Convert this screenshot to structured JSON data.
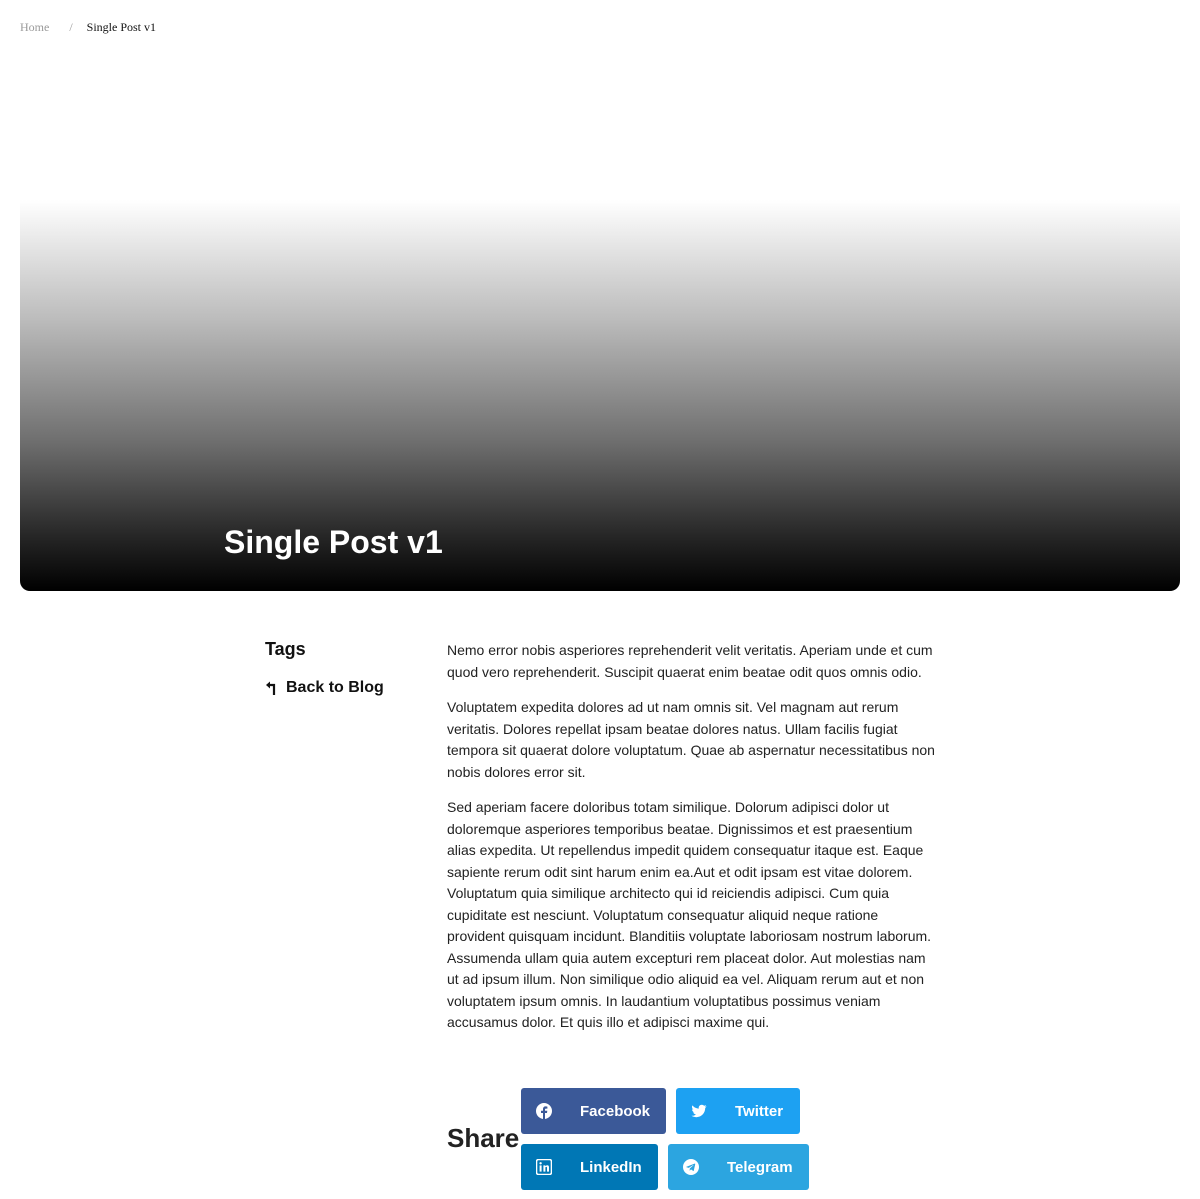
{
  "breadcrumb": {
    "home": "Home",
    "separator": "/",
    "current": "Single Post v1"
  },
  "hero": {
    "title": "Single Post v1"
  },
  "sidebar": {
    "tags_heading": "Tags",
    "back_label": "Back to Blog",
    "back_icon": "arrow-up-left-icon"
  },
  "article": {
    "paragraphs": [
      "Nemo error nobis asperiores reprehenderit velit veritatis. Aperiam unde et cum quod vero reprehenderit. Suscipit quaerat enim beatae odit quos omnis odio.",
      "Voluptatem expedita dolores ad ut nam omnis sit. Vel magnam aut rerum veritatis. Dolores repellat ipsam beatae dolores natus. Ullam facilis fugiat tempora sit quaerat dolore voluptatum. Quae ab aspernatur necessitatibus non nobis dolores error sit.",
      "Sed aperiam facere doloribus totam similique. Dolorum adipisci dolor ut doloremque asperiores temporibus beatae. Dignissimos et est praesentium alias expedita. Ut repellendus impedit quidem consequatur itaque est. Eaque sapiente rerum odit sint harum enim ea.Aut et odit ipsam est vitae dolorem. Voluptatum quia similique architecto qui id reiciendis adipisci. Cum quia cupiditate est nesciunt. Voluptatum consequatur aliquid neque ratione provident quisquam incidunt. Blanditiis voluptate laboriosam nostrum laborum. Assumenda ullam quia autem excepturi rem placeat dolor. Aut molestias nam ut ad ipsum illum. Non similique odio aliquid ea vel. Aliquam rerum aut et non voluptatem ipsum omnis. In laudantium voluptatibus possimus veniam accusamus dolor. Et quis illo et adipisci maxime qui."
    ]
  },
  "share": {
    "heading": "Share",
    "buttons": [
      {
        "label": "Facebook",
        "icon": "facebook-icon",
        "color": "#3b5998"
      },
      {
        "label": "Twitter",
        "icon": "twitter-icon",
        "color": "#1da1f2"
      },
      {
        "label": "LinkedIn",
        "icon": "linkedin-icon",
        "color": "#0077b5"
      },
      {
        "label": "Telegram",
        "icon": "telegram-icon",
        "color": "#2ca5e0"
      }
    ]
  }
}
